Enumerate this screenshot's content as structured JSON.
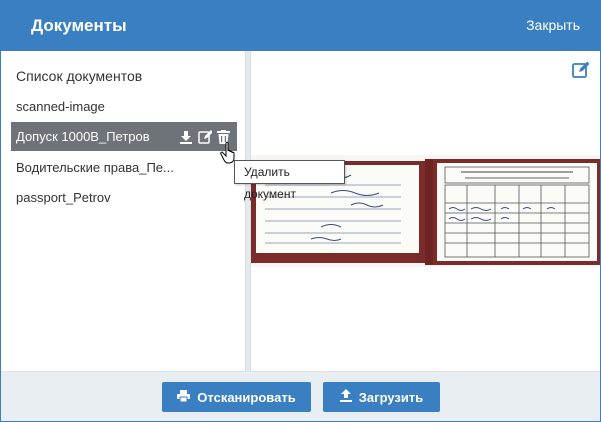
{
  "header": {
    "title": "Документы",
    "close_label": "Закрыть"
  },
  "sidebar": {
    "list_title": "Список документов",
    "items": [
      {
        "label": "scanned-image",
        "selected": false
      },
      {
        "label": "Допуск 1000В_Петров",
        "selected": true
      },
      {
        "label": "Водительские права_Пе...",
        "selected": false
      },
      {
        "label": "passport_Petrov",
        "selected": false
      }
    ],
    "item_actions": [
      "download-icon",
      "edit-icon",
      "trash-icon"
    ]
  },
  "tooltip": {
    "text": "Удалить документ"
  },
  "footer": {
    "scan_label": "Отсканировать",
    "upload_label": "Загрузить"
  },
  "colors": {
    "accent": "#3a7fc1",
    "selected_row": "#6d7378",
    "footer_bg": "#e9eef3"
  }
}
